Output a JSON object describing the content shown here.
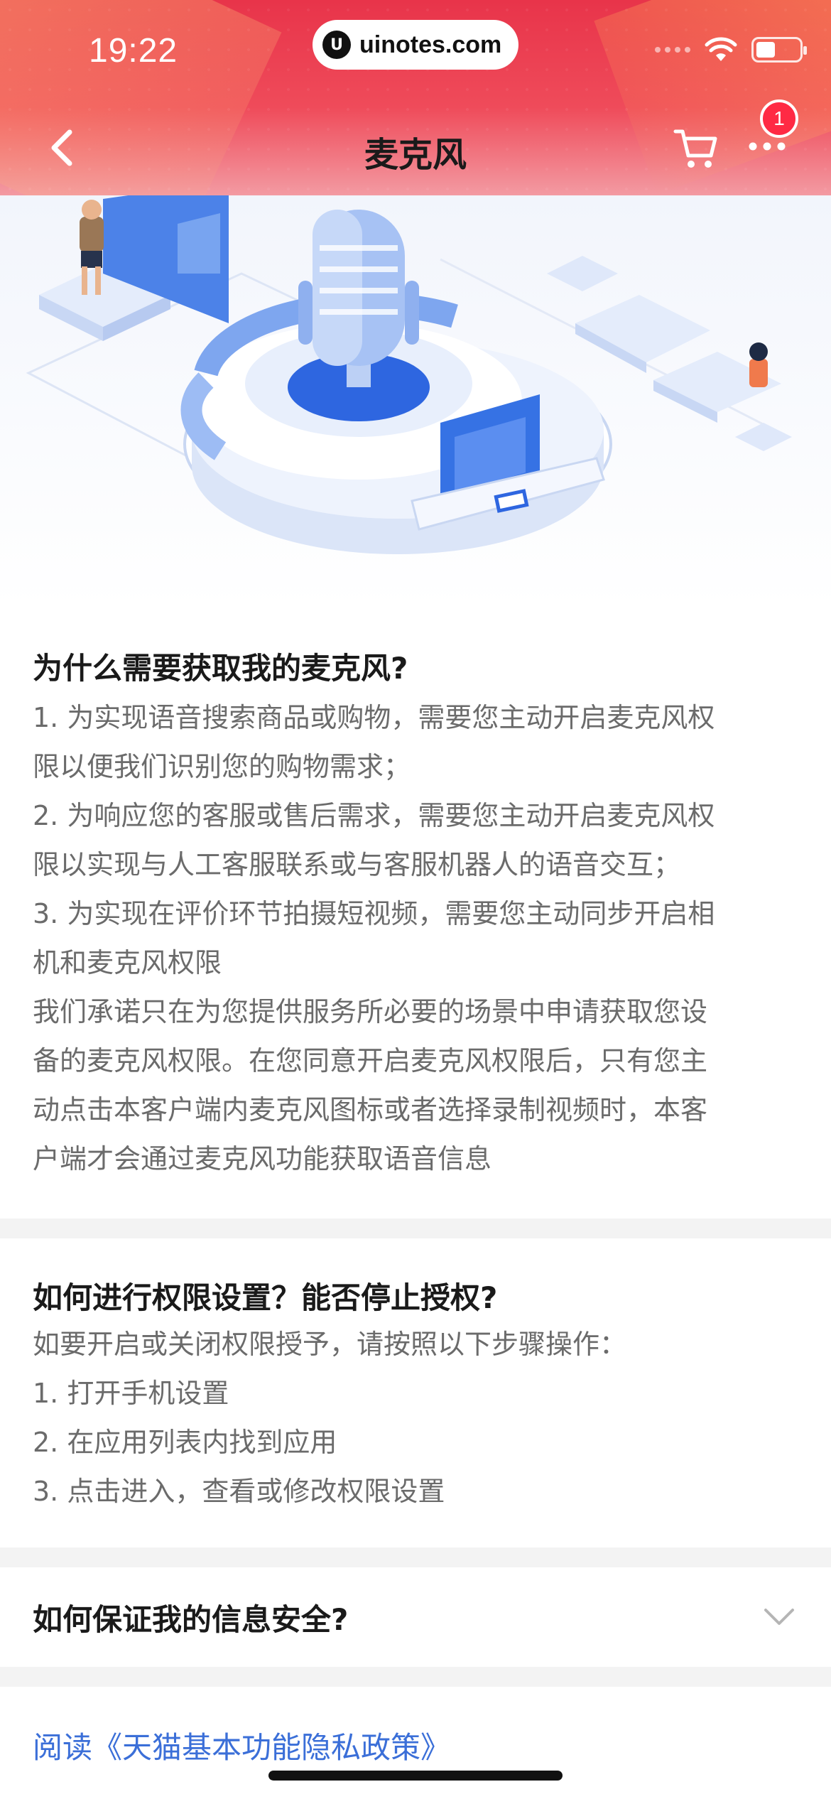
{
  "status_bar": {
    "time": "19:22",
    "url": "uinotes.com"
  },
  "nav": {
    "title": "麦克风",
    "badge_count": "1"
  },
  "section1": {
    "title": "为什么需要获取我的麦克风?",
    "lines": [
      "1. 为实现语音搜索商品或购物，需要您主动开启麦克风权",
      "限以便我们识别您的购物需求；",
      "2. 为响应您的客服或售后需求，需要您主动开启麦克风权",
      "限以实现与人工客服联系或与客服机器人的语音交互；",
      "3. 为实现在评价环节拍摄短视频，需要您主动同步开启相",
      "机和麦克风权限",
      "我们承诺只在为您提供服务所必要的场景中申请获取您设",
      "备的麦克风权限。在您同意开启麦克风权限后，只有您主",
      "动点击本客户端内麦克风图标或者选择录制视频时，本客",
      "户端才会通过麦克风功能获取语音信息"
    ]
  },
  "section2": {
    "title": "如何进行权限设置？能否停止授权?",
    "lines": [
      "如要开启或关闭权限授予，请按照以下步骤操作：",
      "1. 打开手机设置",
      "2. 在应用列表内找到应用",
      "3. 点击进入，查看或修改权限设置"
    ]
  },
  "section3": {
    "title": "如何保证我的信息安全?"
  },
  "footer": {
    "privacy_link": "阅读《天猫基本功能隐私政策》"
  }
}
